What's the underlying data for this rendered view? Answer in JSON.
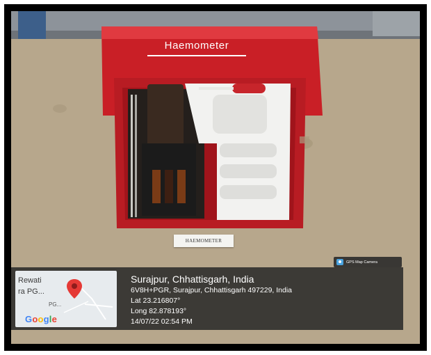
{
  "product": {
    "box_brand": "Haemometer",
    "label_card": "HAEMOMETER"
  },
  "gps_badge": {
    "label": "GPS Map Camera",
    "icon": "camera-icon"
  },
  "map": {
    "place_line1": "Rewati",
    "place_line2": "ra PG...",
    "place_line3": "PG...",
    "provider": "Google",
    "pin_icon": "map-pin-icon"
  },
  "location": {
    "title": "Surajpur, Chhattisgarh, India",
    "address": "6V8H+PGR, Surajpur, Chhattisgarh 497229, India",
    "lat": "Lat 23.216807°",
    "long": "Long 82.878193°",
    "datetime": "14/07/22 02:54 PM"
  },
  "colors": {
    "box_red": "#d32027",
    "tray_white": "#f2f2f0",
    "overlay": "#282828"
  }
}
